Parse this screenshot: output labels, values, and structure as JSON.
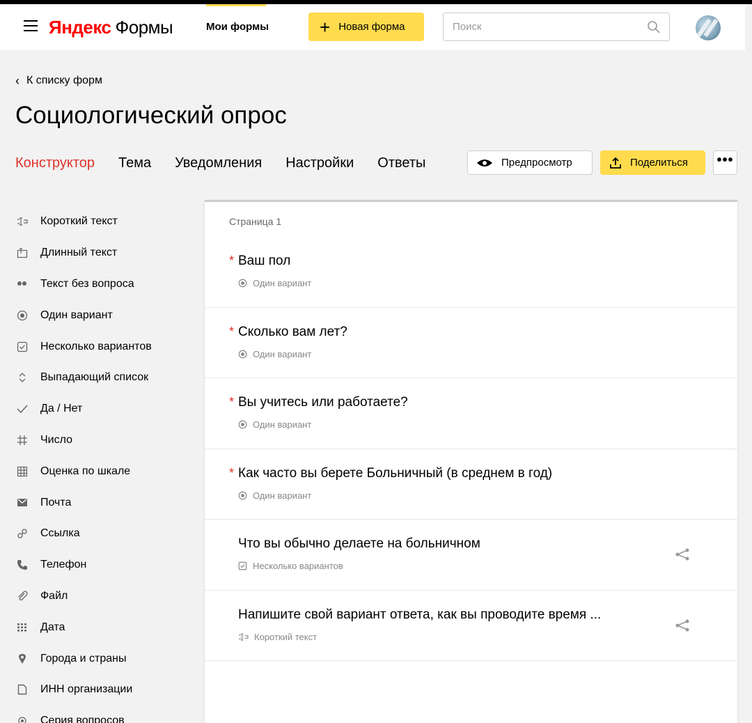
{
  "header": {
    "logo_brand": "Яндекс",
    "logo_product": "Формы",
    "nav_my_forms": "Мои формы",
    "new_form_label": "Новая форма",
    "search_placeholder": "Поиск",
    "search_value": ""
  },
  "back_link": "К списку форм",
  "page_title": "Социологический опрос",
  "tabs": [
    {
      "label": "Конструктор",
      "active": true
    },
    {
      "label": "Тема"
    },
    {
      "label": "Уведомления"
    },
    {
      "label": "Настройки"
    },
    {
      "label": "Ответы"
    }
  ],
  "actions": {
    "preview_label": "Предпросмотр",
    "share_label": "Поделиться",
    "more_label": "•••"
  },
  "sidebar": {
    "items": [
      {
        "label": "Короткий текст",
        "icon": "short-text-icon"
      },
      {
        "label": "Длинный текст",
        "icon": "long-text-icon"
      },
      {
        "label": "Текст без вопроса",
        "icon": "quote-icon"
      },
      {
        "label": "Один вариант",
        "icon": "radio-icon"
      },
      {
        "label": "Несколько вариантов",
        "icon": "checkbox-icon"
      },
      {
        "label": "Выпадающий список",
        "icon": "dropdown-icon"
      },
      {
        "label": "Да / Нет",
        "icon": "check-icon"
      },
      {
        "label": "Число",
        "icon": "hash-icon"
      },
      {
        "label": "Оценка по шкале",
        "icon": "grid-icon"
      },
      {
        "label": "Почта",
        "icon": "mail-icon"
      },
      {
        "label": "Ссылка",
        "icon": "link-icon"
      },
      {
        "label": "Телефон",
        "icon": "phone-icon"
      },
      {
        "label": "Файл",
        "icon": "paperclip-icon"
      },
      {
        "label": "Дата",
        "icon": "calendar-icon"
      },
      {
        "label": "Города и страны",
        "icon": "location-icon"
      },
      {
        "label": "ИНН организации",
        "icon": "document-icon"
      },
      {
        "label": "Серия вопросов",
        "icon": "series-icon"
      }
    ]
  },
  "panel": {
    "page_label": "Страница 1",
    "questions": [
      {
        "title": "Ваш пол",
        "required": true,
        "type": "Один вариант",
        "type_icon": "radio-icon",
        "branch": false
      },
      {
        "title": "Сколько вам лет?",
        "required": true,
        "type": "Один вариант",
        "type_icon": "radio-icon",
        "branch": false
      },
      {
        "title": "Вы учитесь или работаете?",
        "required": true,
        "type": "Один вариант",
        "type_icon": "radio-icon",
        "branch": false
      },
      {
        "title": "Как часто вы берете Больничный (в среднем в год)",
        "required": true,
        "type": "Один вариант",
        "type_icon": "radio-icon",
        "branch": false
      },
      {
        "title": "Что вы обычно делаете на больничном",
        "required": false,
        "type": "Несколько вариантов",
        "type_icon": "checkbox-icon",
        "branch": true
      },
      {
        "title": "Напишите свой вариант ответа, как вы проводите время ...",
        "required": false,
        "type": "Короткий текст",
        "type_icon": "short-text-icon",
        "branch": true
      }
    ],
    "required_marker": "*"
  },
  "colors": {
    "accent_yellow": "#ffdb4d",
    "active_tab_red": "#e0312a",
    "logo_red": "#ff0000"
  }
}
